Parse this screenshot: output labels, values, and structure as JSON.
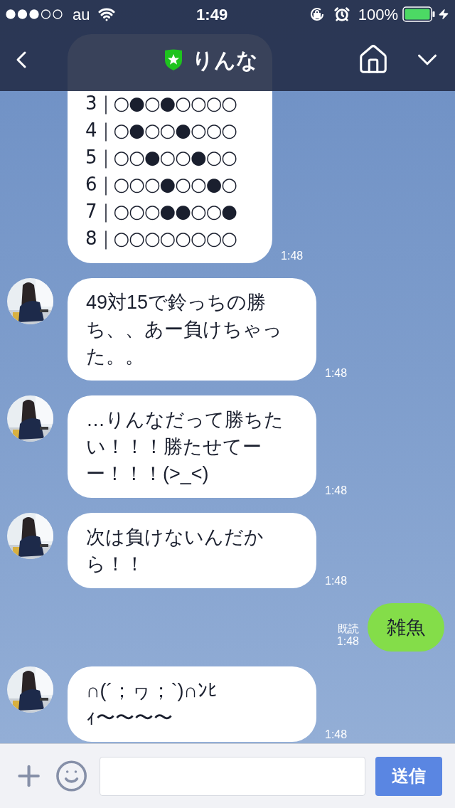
{
  "status_bar": {
    "carrier": "au",
    "time": "1:49",
    "battery": "100%"
  },
  "header": {
    "title": "りんな"
  },
  "messages": [
    {
      "kind": "board",
      "lines": [
        "3｜○●○●○○○○",
        "4｜○●○○●○○○",
        "5｜○○●○○●○○",
        "6｜○○○●○○●○",
        "7｜○○○●●○○●",
        "8｜○○○○○○○○"
      ],
      "time": "1:48"
    },
    {
      "kind": "received",
      "avatar": true,
      "text": "49対15で鈴っちの勝ち、、あー負けちゃった。。",
      "time": "1:48"
    },
    {
      "kind": "received",
      "avatar": true,
      "text": "…りんなだって勝ちたい！！！勝たせてーー！！！(>_<)",
      "time": "1:48"
    },
    {
      "kind": "received",
      "avatar": true,
      "text": "次は負けないんだから！！",
      "time": "1:48"
    },
    {
      "kind": "sent",
      "read": "既読",
      "text": "雑魚",
      "time": "1:48"
    },
    {
      "kind": "received",
      "avatar": true,
      "text": "∩(´；ヮ；`)∩ﾝﾋｨ〜〜〜〜",
      "time": "1:48"
    }
  ],
  "composer": {
    "send": "送信"
  }
}
